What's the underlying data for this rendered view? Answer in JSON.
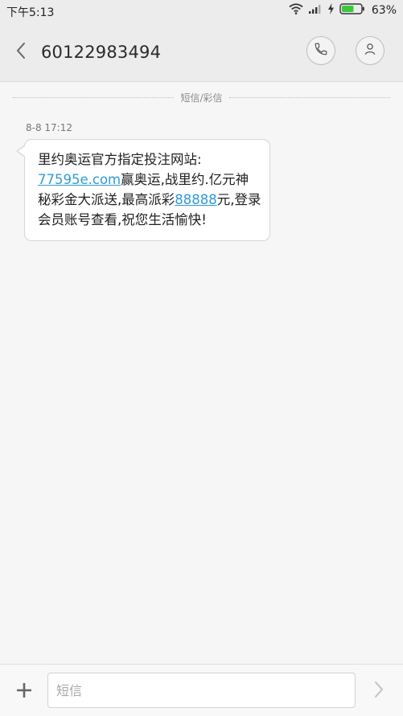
{
  "status_bar": {
    "time": "下午5:13",
    "battery_percent": "63%",
    "battery_level": 0.63,
    "battery_color": "#3cc83c"
  },
  "header": {
    "title": "60122983494",
    "back_icon": "chevron-left-icon",
    "call_icon": "phone-icon",
    "contact_icon": "person-icon"
  },
  "conversation": {
    "divider_label": "短信/彩信",
    "messages": [
      {
        "time": "8-8 17:12",
        "segments": [
          {
            "text": "里约奥运官方指定投注网站:"
          },
          {
            "text": "77595e.com",
            "link": true
          },
          {
            "text": "赢奥运,战里约.亿元神秘彩金大派送,最高派彩"
          },
          {
            "text": "88888",
            "link": true
          },
          {
            "text": "元,登录会员账号查看,祝您生活愉快!"
          }
        ]
      }
    ]
  },
  "composer": {
    "add_icon": "plus-icon",
    "placeholder": "短信",
    "send_icon": "chevron-right-icon"
  },
  "colors": {
    "link": "#2f9bd8",
    "header_bg": "#ececec",
    "bubble_bg": "#ffffff"
  }
}
